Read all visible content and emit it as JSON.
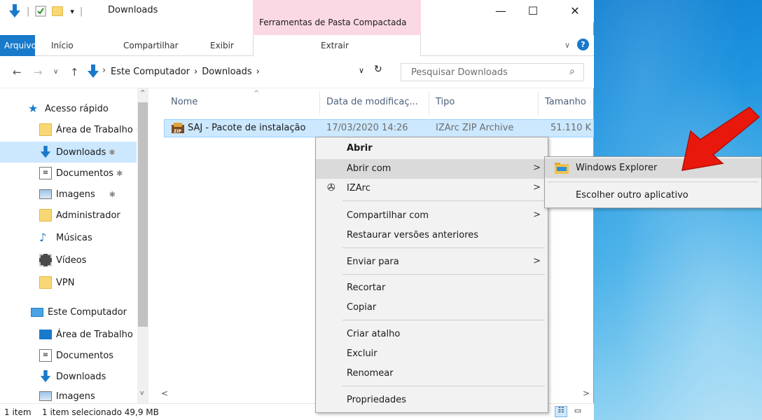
{
  "window": {
    "title": "Downloads",
    "context_tab_group": "Ferramentas de Pasta Compactada",
    "controls": {
      "minimize": "—",
      "maximize": "☐",
      "close": "✕"
    }
  },
  "ribbon": {
    "tabs": [
      "Arquivo",
      "Início",
      "Compartilhar",
      "Exibir"
    ],
    "context_tab": "Extrair"
  },
  "address": {
    "crumbs": [
      "Este Computador",
      "Downloads"
    ],
    "search_placeholder": "Pesquisar Downloads"
  },
  "nav": {
    "items": [
      {
        "label": "Acesso rápido",
        "icon": "star-icon",
        "pinned": false
      },
      {
        "label": "Área de Trabalho",
        "icon": "folder-icon",
        "pinned": true
      },
      {
        "label": "Downloads",
        "icon": "download-icon",
        "pinned": true
      },
      {
        "label": "Documentos",
        "icon": "document-icon",
        "pinned": true
      },
      {
        "label": "Imagens",
        "icon": "image-icon",
        "pinned": true
      },
      {
        "label": "Administrador",
        "icon": "folder-icon",
        "pinned": false
      },
      {
        "label": "Músicas",
        "icon": "music-icon",
        "pinned": false
      },
      {
        "label": "Vídeos",
        "icon": "video-icon",
        "pinned": false
      },
      {
        "label": "VPN",
        "icon": "folder-icon",
        "pinned": false
      },
      {
        "label": "Este Computador",
        "icon": "computer-icon",
        "pinned": false
      },
      {
        "label": "Área de Trabalho",
        "icon": "desktop-icon",
        "pinned": false
      },
      {
        "label": "Documentos",
        "icon": "document-icon",
        "pinned": false
      },
      {
        "label": "Downloads",
        "icon": "download-icon",
        "pinned": false
      },
      {
        "label": "Imagens",
        "icon": "image-icon",
        "pinned": false
      }
    ]
  },
  "list": {
    "columns": [
      "Nome",
      "Data de modificaç...",
      "Tipo",
      "Tamanho"
    ],
    "rows": [
      {
        "name": "SAJ - Pacote de instalação",
        "date": "17/03/2020 14:26",
        "type": "IZArc ZIP Archive",
        "size": "51.110 K"
      }
    ]
  },
  "status": {
    "count": "1 item",
    "selected": "1 item selecionado 49,9 MB"
  },
  "context_menu": {
    "items": [
      "Abrir",
      "Abrir com",
      "IZArc",
      "Compartilhar com",
      "Restaurar versões anteriores",
      "Enviar para",
      "Recortar",
      "Copiar",
      "Criar atalho",
      "Excluir",
      "Renomear",
      "Propriedades"
    ]
  },
  "submenu": {
    "items": [
      "Windows Explorer",
      "Escolher outro aplicativo"
    ]
  },
  "colors": {
    "accent": "#1979ca",
    "selection": "#cce8ff",
    "context_tab": "#fbd9e4",
    "annotation_arrow": "#e8180c"
  }
}
